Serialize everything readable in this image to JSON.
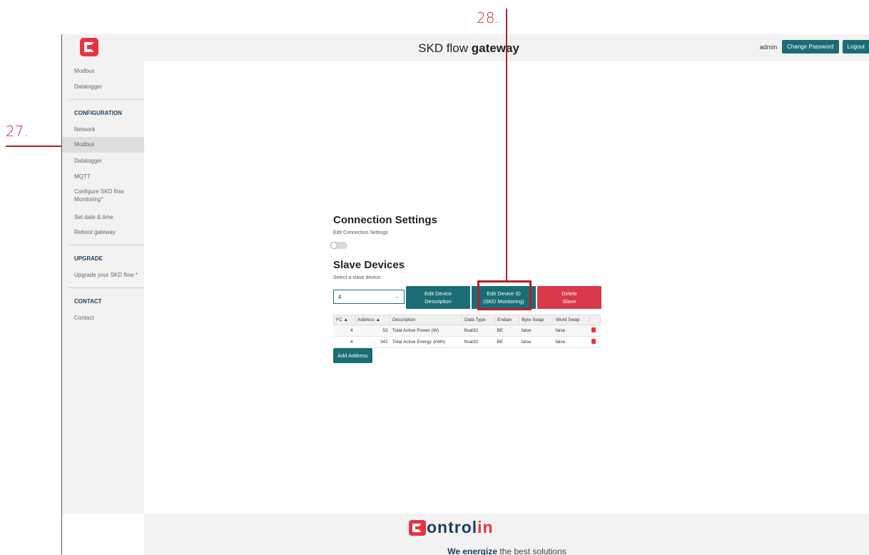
{
  "annotations": {
    "a27": "27.",
    "a28": "28."
  },
  "header": {
    "title_light": "SKD flow ",
    "title_bold": "gateway",
    "user": "admin",
    "change_password": "Change Password",
    "logout": "Logout"
  },
  "sidebar": {
    "top_items": [
      "Modbus",
      "Datalogger"
    ],
    "configuration_heading": "CONFIGURATION",
    "configuration_items": [
      "Network",
      "Modbus",
      "Datalogger",
      "MQTT",
      "Configure SKD flow Monitoring*",
      "Set date & time",
      "Reboot gateway"
    ],
    "upgrade_heading": "UPGRADE",
    "upgrade_items": [
      "Upgrade your SKD flow *"
    ],
    "contact_heading": "CONTACT",
    "contact_items": [
      "Contact"
    ]
  },
  "main": {
    "connection_title": "Connection Settings",
    "connection_toggle_label": "Edit Connection Settings",
    "slave_title": "Slave Devices",
    "slave_select_label": "Select a slave device:",
    "slave_select_value": "4",
    "btn_edit_desc_1": "Edit Device",
    "btn_edit_desc_2": "Description",
    "btn_edit_id_1": "Edit Device ID",
    "btn_edit_id_2": "(SKD Monitoring)",
    "btn_delete_1": "Delete",
    "btn_delete_2": "Slave",
    "table_headers": [
      "FC ▲",
      "Address ▲",
      "Description",
      "Data Type",
      "Endian",
      "Byte Swap",
      "Word Swap"
    ],
    "rows": [
      [
        "4",
        "52",
        "Total Active Power (W)",
        "float32",
        "BE",
        "false",
        "false"
      ],
      [
        "4",
        "342",
        "Total Active Energy (kWh)",
        "float32",
        "BE",
        "false",
        "false"
      ]
    ],
    "add_address": "Add Address"
  },
  "footer": {
    "brand_rest": "ontrol",
    "brand_accent": "in",
    "tag_bold": "We energize",
    "tag_rest": " the best solutions"
  },
  "colors": {
    "accent_teal": "#1a6d74",
    "accent_red": "#d9394b",
    "annotation": "#b82027"
  }
}
